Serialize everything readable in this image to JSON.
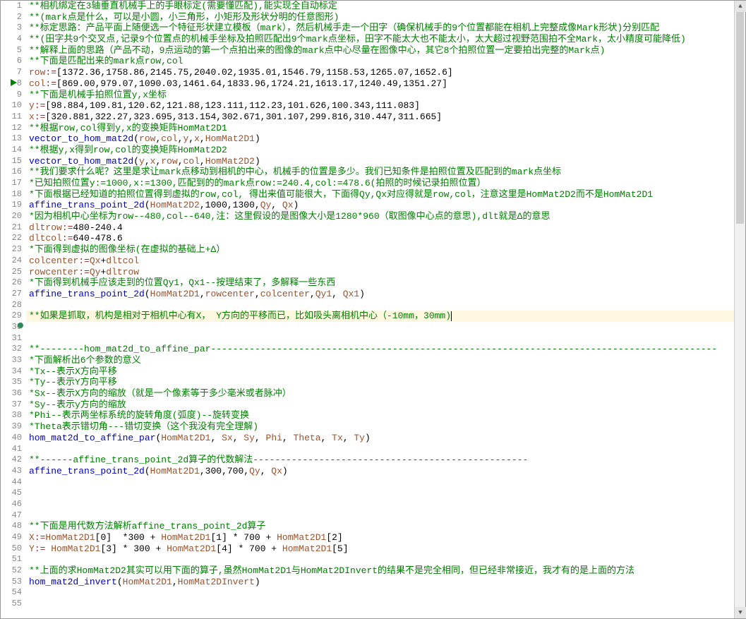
{
  "activeLine": 29,
  "execMarkerLine": 8,
  "bpDotLine": 30,
  "lines": [
    {
      "n": 1,
      "tokens": [
        {
          "c": "comment-g",
          "t": "**相机绑定在3轴垂直机械手上的手眼标定(需要懂匹配),能实现全自动标定"
        }
      ]
    },
    {
      "n": 2,
      "tokens": [
        {
          "c": "comment-g",
          "t": "**(mark点是什么，可以是小圆，小三角形，小矩形及形状分明的任意图形)"
        }
      ]
    },
    {
      "n": 3,
      "tokens": [
        {
          "c": "comment-g",
          "t": "**标定思路：产品平面上随便选一个特征形状建立模板（mark），然后机械手走一个田字（确保机械手的9个位置都能在相机上完整成像Mark形状)分别匹配"
        }
      ]
    },
    {
      "n": 4,
      "tokens": [
        {
          "c": "comment-g",
          "t": "**(田字共9个交叉点,记录9个位置点的机械手坐标及拍照匹配出9个mark点坐标，田字不能太大也不能太小，太大超过视野范围拍不全Mark，太小精度可能降低)"
        }
      ]
    },
    {
      "n": 5,
      "tokens": [
        {
          "c": "comment-g",
          "t": "**解释上面的思路（产品不动，9点运动的第一个点拍出来的图像的mark点中心尽量在图像中心，其它8个拍照位置一定要拍出完整的Mark点)"
        }
      ]
    },
    {
      "n": 6,
      "tokens": [
        {
          "c": "comment-g",
          "t": "**下面是匹配出来的mark点row,col"
        }
      ]
    },
    {
      "n": 7,
      "tokens": [
        {
          "c": "brown",
          "t": "row"
        },
        {
          "c": "op",
          "t": ":="
        },
        {
          "c": "black",
          "t": "[1372.36,1758.86,2145.75,2040.02,1935.01,1546.79,1158.53,1265.07,1652.6]"
        }
      ]
    },
    {
      "n": 8,
      "tokens": [
        {
          "c": "brown",
          "t": "col"
        },
        {
          "c": "op",
          "t": ":="
        },
        {
          "c": "black",
          "t": "[869.00,979.07,1090.03,1461.64,1833.96,1724.21,1613.17,1240.49,1351.27]"
        }
      ]
    },
    {
      "n": 9,
      "tokens": [
        {
          "c": "comment-g",
          "t": "**下面是机械手拍照位置y,x坐标"
        }
      ]
    },
    {
      "n": 10,
      "tokens": [
        {
          "c": "brown",
          "t": "y"
        },
        {
          "c": "op",
          "t": ":="
        },
        {
          "c": "black",
          "t": "[98.884,109.81,120.62,121.88,123.111,112.23,101.626,100.343,111.083]"
        }
      ]
    },
    {
      "n": 11,
      "tokens": [
        {
          "c": "brown",
          "t": "x"
        },
        {
          "c": "op",
          "t": ":="
        },
        {
          "c": "black",
          "t": "[320.881,322.27,323.695,313.154,302.671,301.107,299.816,310.447,311.665]"
        }
      ]
    },
    {
      "n": 12,
      "tokens": [
        {
          "c": "comment-g",
          "t": "**根据row,col得到y,x的变换矩阵HomMat2D1"
        }
      ]
    },
    {
      "n": 13,
      "tokens": [
        {
          "c": "keyword",
          "t": "vector_to_hom_mat2d"
        },
        {
          "c": "black",
          "t": "("
        },
        {
          "c": "brown",
          "t": "row"
        },
        {
          "c": "black",
          "t": ","
        },
        {
          "c": "brown",
          "t": "col"
        },
        {
          "c": "black",
          "t": ","
        },
        {
          "c": "brown",
          "t": "y"
        },
        {
          "c": "black",
          "t": ","
        },
        {
          "c": "brown",
          "t": "x"
        },
        {
          "c": "black",
          "t": ","
        },
        {
          "c": "brown",
          "t": "HomMat2D1"
        },
        {
          "c": "black",
          "t": ")"
        }
      ]
    },
    {
      "n": 14,
      "tokens": [
        {
          "c": "comment-g",
          "t": "**根据y,x得到row,col的变换矩阵HomMat2D2"
        }
      ]
    },
    {
      "n": 15,
      "tokens": [
        {
          "c": "keyword",
          "t": "vector_to_hom_mat2d"
        },
        {
          "c": "black",
          "t": "("
        },
        {
          "c": "brown",
          "t": "y"
        },
        {
          "c": "black",
          "t": ","
        },
        {
          "c": "brown",
          "t": "x"
        },
        {
          "c": "black",
          "t": ","
        },
        {
          "c": "brown",
          "t": "row"
        },
        {
          "c": "black",
          "t": ","
        },
        {
          "c": "brown",
          "t": "col"
        },
        {
          "c": "black",
          "t": ","
        },
        {
          "c": "brown",
          "t": "HomMat2D2"
        },
        {
          "c": "black",
          "t": ")"
        }
      ]
    },
    {
      "n": 16,
      "tokens": [
        {
          "c": "comment-g",
          "t": "**我们要求什么呢？这里是求让mark点移动到相机的中心，机械手的位置是多少。我们已知条件是拍照位置及匹配到的mark点坐标"
        }
      ]
    },
    {
      "n": 17,
      "tokens": [
        {
          "c": "comment-g",
          "t": "*已知拍照位置y:=1000,x:=1300,匹配到的的mark点row:=240.4,col:=478.6(拍照的时候记录拍照位置）"
        }
      ]
    },
    {
      "n": 18,
      "tokens": [
        {
          "c": "comment-g",
          "t": "*下面根据已经知道的拍照位置得到虚拟的row,col, 得出来值可能很大，下面得Qy,Qx对应得就是row,col，注意这里是HomMat2D2而不是HomMat2D1"
        }
      ]
    },
    {
      "n": 19,
      "tokens": [
        {
          "c": "keyword",
          "t": "affine_trans_point_2d"
        },
        {
          "c": "black",
          "t": "("
        },
        {
          "c": "brown",
          "t": "HomMat2D2"
        },
        {
          "c": "black",
          "t": ",1000,1300,"
        },
        {
          "c": "brown",
          "t": "Qy"
        },
        {
          "c": "black",
          "t": ", "
        },
        {
          "c": "brown",
          "t": "Qx"
        },
        {
          "c": "black",
          "t": ")"
        }
      ]
    },
    {
      "n": 20,
      "tokens": [
        {
          "c": "comment-g",
          "t": "*因为相机中心坐标为row--480,col--640,注：这里假设的是图像大小是1280*960（取图像中心点的意思),dlt就是Δ的意思"
        }
      ]
    },
    {
      "n": 21,
      "tokens": [
        {
          "c": "brown",
          "t": "dltrow"
        },
        {
          "c": "op",
          "t": ":="
        },
        {
          "c": "black",
          "t": "480-240.4"
        }
      ]
    },
    {
      "n": 22,
      "tokens": [
        {
          "c": "brown",
          "t": "dltcol"
        },
        {
          "c": "op",
          "t": ":="
        },
        {
          "c": "black",
          "t": "640-478.6"
        }
      ]
    },
    {
      "n": 23,
      "tokens": [
        {
          "c": "comment-g",
          "t": "*下面得到虚拟的图像坐标(在虚拟的基础上+Δ）"
        }
      ]
    },
    {
      "n": 24,
      "tokens": [
        {
          "c": "brown",
          "t": "colcenter"
        },
        {
          "c": "op",
          "t": ":="
        },
        {
          "c": "brown",
          "t": "Qx"
        },
        {
          "c": "black",
          "t": "+"
        },
        {
          "c": "brown",
          "t": "dltcol"
        }
      ]
    },
    {
      "n": 25,
      "tokens": [
        {
          "c": "brown",
          "t": "rowcenter"
        },
        {
          "c": "op",
          "t": ":="
        },
        {
          "c": "brown",
          "t": "Qy"
        },
        {
          "c": "black",
          "t": "+"
        },
        {
          "c": "brown",
          "t": "dltrow"
        }
      ]
    },
    {
      "n": 26,
      "tokens": [
        {
          "c": "comment-g",
          "t": "*下面得到机械手应该走到的位置Qy1，Qx1--按理结束了，多解释一些东西"
        }
      ]
    },
    {
      "n": 27,
      "tokens": [
        {
          "c": "keyword",
          "t": "affine_trans_point_2d"
        },
        {
          "c": "black",
          "t": "("
        },
        {
          "c": "brown",
          "t": "HomMat2D1"
        },
        {
          "c": "black",
          "t": ","
        },
        {
          "c": "brown",
          "t": "rowcenter"
        },
        {
          "c": "black",
          "t": ","
        },
        {
          "c": "brown",
          "t": "colcenter"
        },
        {
          "c": "black",
          "t": ","
        },
        {
          "c": "brown",
          "t": "Qy1"
        },
        {
          "c": "black",
          "t": ", "
        },
        {
          "c": "brown",
          "t": "Qx1"
        },
        {
          "c": "black",
          "t": ")"
        }
      ]
    },
    {
      "n": 28,
      "tokens": []
    },
    {
      "n": 29,
      "tokens": [
        {
          "c": "comment-g",
          "t": "**如果是抓取，机构是相对于相机中心有X， Y方向的平移而已，比如吸头离相机中心（-10mm，30mm)"
        }
      ],
      "cursor": true
    },
    {
      "n": 30,
      "tokens": []
    },
    {
      "n": 31,
      "tokens": []
    },
    {
      "n": 32,
      "tokens": [
        {
          "c": "comment-g",
          "t": "**--------hom_mat2d_to_affine_par--------------------------------------------------------------------------------------------"
        }
      ]
    },
    {
      "n": 33,
      "tokens": [
        {
          "c": "comment-g",
          "t": "*下面解析出6个参数的意义"
        }
      ]
    },
    {
      "n": 34,
      "tokens": [
        {
          "c": "comment-g",
          "t": "*Tx--表示X方向平移"
        }
      ]
    },
    {
      "n": 35,
      "tokens": [
        {
          "c": "comment-g",
          "t": "*Ty--表示Y方向平移"
        }
      ]
    },
    {
      "n": 36,
      "tokens": [
        {
          "c": "comment-g",
          "t": "*Sx--表示X方向的缩放（就是一个像素等于多少毫米或者脉冲）"
        }
      ]
    },
    {
      "n": 37,
      "tokens": [
        {
          "c": "comment-g",
          "t": "*Sy--表示y方向的缩放"
        }
      ]
    },
    {
      "n": 38,
      "tokens": [
        {
          "c": "comment-g",
          "t": "*Phi--表示两坐标系统的旋转角度(弧度)--旋转变换"
        }
      ]
    },
    {
      "n": 39,
      "tokens": [
        {
          "c": "comment-g",
          "t": "*Theta表示错切角---错切变换（这个我没有完全理解)"
        }
      ]
    },
    {
      "n": 40,
      "tokens": [
        {
          "c": "keyword",
          "t": "hom_mat2d_to_affine_par"
        },
        {
          "c": "black",
          "t": "("
        },
        {
          "c": "brown",
          "t": "HomMat2D1"
        },
        {
          "c": "black",
          "t": ", "
        },
        {
          "c": "brown",
          "t": "Sx"
        },
        {
          "c": "black",
          "t": ", "
        },
        {
          "c": "brown",
          "t": "Sy"
        },
        {
          "c": "black",
          "t": ", "
        },
        {
          "c": "brown",
          "t": "Phi"
        },
        {
          "c": "black",
          "t": ", "
        },
        {
          "c": "brown",
          "t": "Theta"
        },
        {
          "c": "black",
          "t": ", "
        },
        {
          "c": "brown",
          "t": "Tx"
        },
        {
          "c": "black",
          "t": ", "
        },
        {
          "c": "brown",
          "t": "Ty"
        },
        {
          "c": "black",
          "t": ")"
        }
      ]
    },
    {
      "n": 41,
      "tokens": []
    },
    {
      "n": 42,
      "tokens": [
        {
          "c": "comment-g",
          "t": "**------affine_trans_point_2d算子的代数解法--------------------------------------------------"
        }
      ]
    },
    {
      "n": 43,
      "tokens": [
        {
          "c": "keyword",
          "t": "affine_trans_point_2d"
        },
        {
          "c": "black",
          "t": "("
        },
        {
          "c": "brown",
          "t": "HomMat2D1"
        },
        {
          "c": "black",
          "t": ",300,700,"
        },
        {
          "c": "brown",
          "t": "Qy"
        },
        {
          "c": "black",
          "t": ", "
        },
        {
          "c": "brown",
          "t": "Qx"
        },
        {
          "c": "black",
          "t": ")"
        }
      ]
    },
    {
      "n": 44,
      "tokens": []
    },
    {
      "n": 45,
      "tokens": []
    },
    {
      "n": 46,
      "tokens": []
    },
    {
      "n": 47,
      "tokens": []
    },
    {
      "n": 48,
      "tokens": [
        {
          "c": "comment-g",
          "t": "**下面是用代数方法解析affine_trans_point_2d算子"
        }
      ]
    },
    {
      "n": 49,
      "tokens": [
        {
          "c": "brown",
          "t": "X"
        },
        {
          "c": "op",
          "t": ":="
        },
        {
          "c": "brown",
          "t": "HomMat2D1"
        },
        {
          "c": "black",
          "t": "[0]  *300 + "
        },
        {
          "c": "brown",
          "t": "HomMat2D1"
        },
        {
          "c": "black",
          "t": "[1] * 700 + "
        },
        {
          "c": "brown",
          "t": "HomMat2D1"
        },
        {
          "c": "black",
          "t": "[2]"
        }
      ]
    },
    {
      "n": 50,
      "tokens": [
        {
          "c": "brown",
          "t": "Y"
        },
        {
          "c": "op",
          "t": ":= "
        },
        {
          "c": "brown",
          "t": "HomMat2D1"
        },
        {
          "c": "black",
          "t": "[3] * 300 + "
        },
        {
          "c": "brown",
          "t": "HomMat2D1"
        },
        {
          "c": "black",
          "t": "[4] * 700 + "
        },
        {
          "c": "brown",
          "t": "HomMat2D1"
        },
        {
          "c": "black",
          "t": "[5]"
        }
      ]
    },
    {
      "n": 51,
      "tokens": []
    },
    {
      "n": 52,
      "tokens": [
        {
          "c": "comment-g",
          "t": "**上面的求HomMat2D2其实可以用下面的算子,虽然HomMat2D1与HomMat2DInvert的结果不是完全相同，但已经非常接近，我才有的是上面的方法"
        }
      ]
    },
    {
      "n": 53,
      "tokens": [
        {
          "c": "keyword",
          "t": "hom_mat2d_invert"
        },
        {
          "c": "black",
          "t": "("
        },
        {
          "c": "brown",
          "t": "HomMat2D1"
        },
        {
          "c": "black",
          "t": ","
        },
        {
          "c": "brown",
          "t": "HomMat2DInvert"
        },
        {
          "c": "black",
          "t": ")"
        }
      ]
    },
    {
      "n": 54,
      "tokens": []
    },
    {
      "n": 55,
      "tokens": []
    }
  ]
}
